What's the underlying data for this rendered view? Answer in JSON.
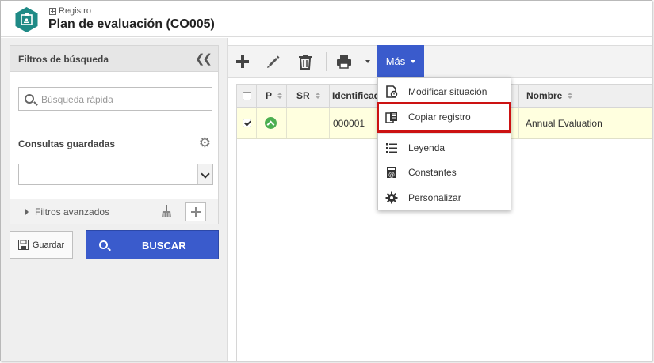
{
  "header": {
    "breadcrumb": "Registro",
    "title": "Plan de evaluación (CO005)"
  },
  "left_panel": {
    "filters_title": "Filtros de búsqueda",
    "search_placeholder": "Búsqueda rápida",
    "saved_queries_label": "Consultas guardadas",
    "saved_queries_value": "",
    "advanced_filters_label": "Filtros avanzados",
    "save_label": "Guardar",
    "search_button_label": "BUSCAR"
  },
  "toolbar": {
    "more_label": "Más",
    "icons": [
      "plus-icon",
      "pencil-icon",
      "trash-icon",
      "printer-icon",
      "chevron-down-icon"
    ]
  },
  "table": {
    "columns": [
      "P",
      "SR",
      "Identificador",
      "Nombre"
    ],
    "rows": [
      {
        "checked": true,
        "status": "ok",
        "sr": "",
        "id": "000001",
        "name": "Annual Evaluation"
      }
    ]
  },
  "dropdown": {
    "items": [
      {
        "label": "Modificar situación",
        "icon": "modify-status-icon"
      },
      {
        "label": "Copiar registro",
        "icon": "copy-record-icon"
      },
      {
        "label": "Leyenda",
        "icon": "legend-icon"
      },
      {
        "label": "Constantes",
        "icon": "constants-icon"
      },
      {
        "label": "Personalizar",
        "icon": "gear-icon"
      }
    ],
    "highlighted": "Copiar registro"
  },
  "colors": {
    "accent": "#3a5bcc",
    "highlight_border": "#cc1212",
    "row_selected": "#ffffdf",
    "app_icon": "#1f8a86",
    "status_ok": "#4caf50"
  }
}
